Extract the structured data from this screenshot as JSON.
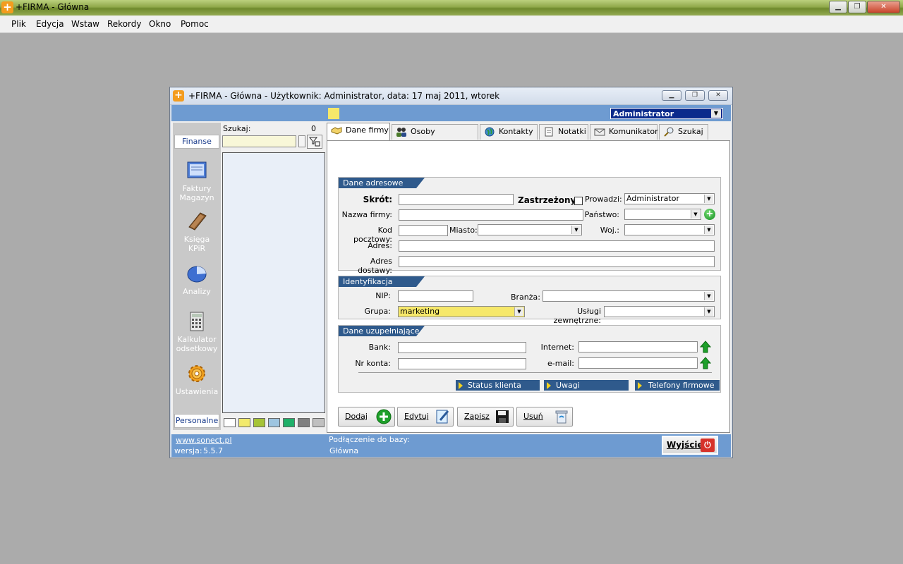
{
  "app": {
    "title": "+FIRMA - Główna"
  },
  "menu": [
    "Plik",
    "Edycja",
    "Wstaw",
    "Rekordy",
    "Okno",
    "Pomoc"
  ],
  "window": {
    "title": "+FIRMA - Główna - Użytkownik:  Administrator, data: 17 maj 2011, wtorek",
    "user_selected": "Administrator"
  },
  "leftnav": {
    "top_tab": "Finanse",
    "bottom_tab": "Personalne",
    "items": [
      {
        "line1": "Faktury",
        "line2": "Magazyn",
        "icon": "invoice-icon"
      },
      {
        "line1": "Księga",
        "line2": "KPiR",
        "icon": "book-icon"
      },
      {
        "line1": "Analizy",
        "line2": "",
        "icon": "pie-chart-icon"
      },
      {
        "line1": "Kalkulator",
        "line2": "odsetkowy",
        "icon": "calculator-icon"
      },
      {
        "line1": "Ustawienia",
        "line2": "",
        "icon": "gear-icon"
      }
    ]
  },
  "search": {
    "label": "Szukaj:",
    "count": "0"
  },
  "swatches": [
    "#ffffff",
    "#f2ea6c",
    "#a6c437",
    "#9ec5e0",
    "#1fb069",
    "#808080",
    "#c0c0c0"
  ],
  "tabs": [
    "Dane firmy",
    "Osoby kontaktów",
    "Kontakty",
    "Notatki",
    "Komunikator",
    "Szukaj"
  ],
  "address": {
    "header": "Dane adresowe",
    "skrot": "Skrót:",
    "zastrzezony": "Zastrzeżony:",
    "prowadzi": "Prowadzi:",
    "prowadzi_value": "Administrator",
    "nazwa": "Nazwa firmy:",
    "panstwo": "Państwo:",
    "kod": "Kod pocztowy:",
    "miasto": "Miasto:",
    "woj": "Woj.:",
    "adres": "Adres:",
    "adres_dostawy": "Adres dostawy:"
  },
  "ident": {
    "header": "Identyfikacja",
    "nip": "NIP:",
    "branza": "Branża:",
    "grupa": "Grupa:",
    "grupa_value": "marketing",
    "uslugi": "Usługi zewnętrzne:"
  },
  "extra": {
    "header": "Dane uzupełniające",
    "bank": "Bank:",
    "internet": "Internet:",
    "nr_konta": "Nr konta:",
    "email": "e-mail:",
    "status_buttons": [
      "Status klienta",
      "Uwagi",
      "Telefony firmowe"
    ]
  },
  "actions": [
    "Dodaj",
    "Edytuj",
    "Zapisz",
    "Usuń"
  ],
  "status": {
    "link": "www.sonect.pl",
    "wersja_label": "wersja:",
    "wersja": "5.5.7",
    "db_label": "Podłączenie do bazy:",
    "db_value": "Główna",
    "exit": "Wyjście"
  },
  "colors": {
    "accent_blue": "#6e9bd1",
    "header_navy": "#2f5a8c",
    "user_dd": "#0a2a8c",
    "grupa_bg": "#f6e86a"
  }
}
